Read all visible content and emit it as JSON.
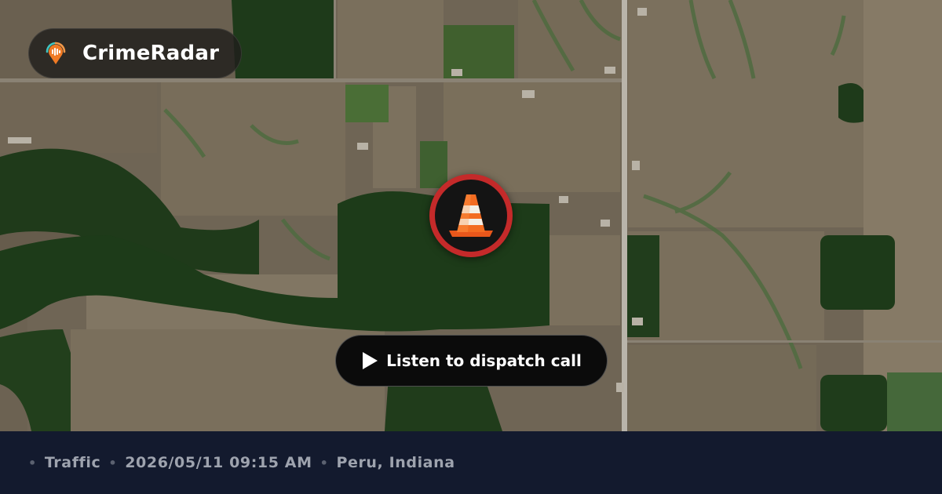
{
  "brand": {
    "name": "CrimeRadar",
    "logo_icon": "radar-pin-icon"
  },
  "incident": {
    "icon": "traffic-cone-icon",
    "ring_color": "#c42a2a"
  },
  "listen_button": {
    "label": "Listen to dispatch call",
    "icon": "play-icon"
  },
  "footer": {
    "separator": "•",
    "category": "Traffic",
    "datetime": "2026/05/11 09:15 AM",
    "location": "Peru, Indiana"
  },
  "map": {
    "style": "satellite"
  }
}
